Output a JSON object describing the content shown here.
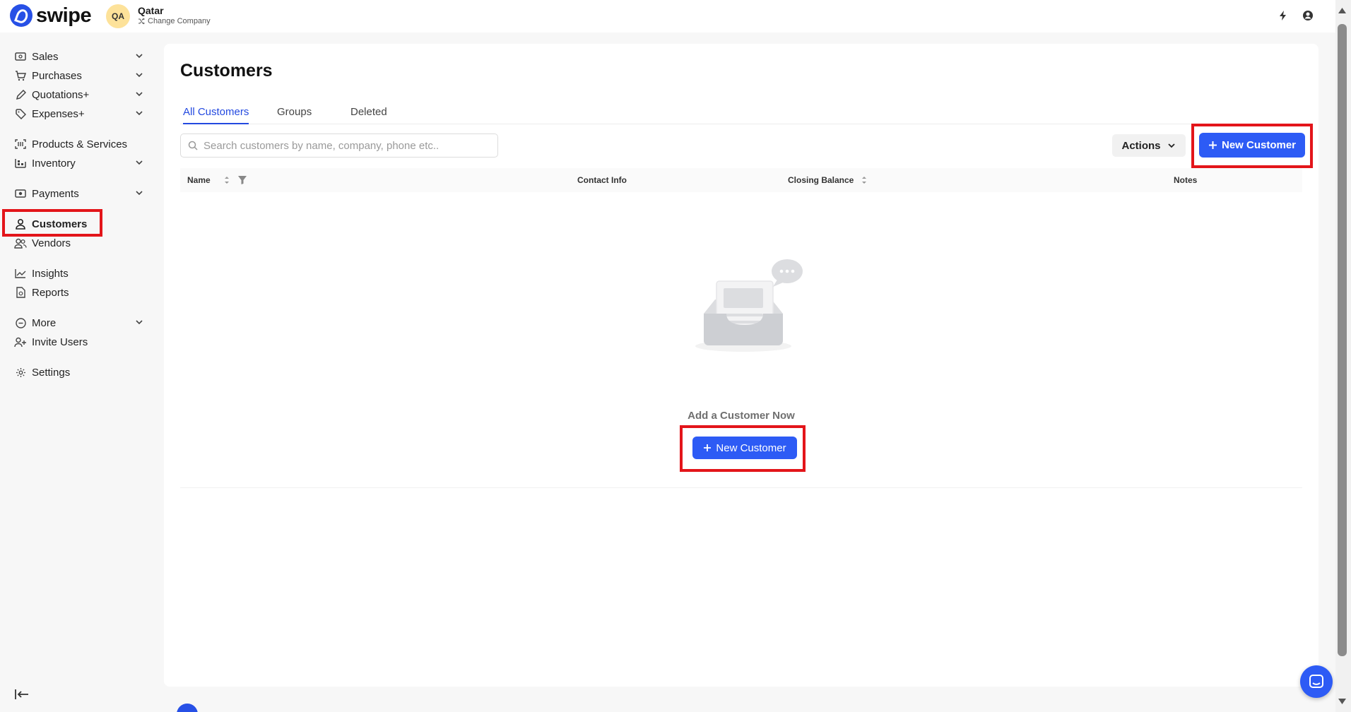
{
  "app": {
    "brand": "swipe",
    "company_initials": "QA",
    "company_name": "Qatar",
    "change_company": "Change Company"
  },
  "sidebar": {
    "items": [
      {
        "label": "Sales",
        "icon": "cash-icon",
        "has_chevron": true
      },
      {
        "label": "Purchases",
        "icon": "cart-icon",
        "has_chevron": true
      },
      {
        "label": "Quotations+",
        "icon": "pencil-icon",
        "has_chevron": true
      },
      {
        "label": "Expenses+",
        "icon": "tag-icon",
        "has_chevron": true
      },
      {
        "label": "Products & Services",
        "icon": "barcode-icon",
        "has_chevron": false
      },
      {
        "label": "Inventory",
        "icon": "warehouse-icon",
        "has_chevron": true
      },
      {
        "label": "Payments",
        "icon": "money-icon",
        "has_chevron": true
      },
      {
        "label": "Customers",
        "icon": "user-icon",
        "has_chevron": false,
        "active": true
      },
      {
        "label": "Vendors",
        "icon": "users-icon",
        "has_chevron": false
      },
      {
        "label": "Insights",
        "icon": "chart-icon",
        "has_chevron": false
      },
      {
        "label": "Reports",
        "icon": "file-icon",
        "has_chevron": false
      },
      {
        "label": "More",
        "icon": "more-circle-icon",
        "has_chevron": true
      },
      {
        "label": "Invite Users",
        "icon": "user-plus-icon",
        "has_chevron": false
      },
      {
        "label": "Settings",
        "icon": "gear-icon",
        "has_chevron": false
      }
    ]
  },
  "main": {
    "title": "Customers",
    "tabs": [
      {
        "label": "All Customers",
        "active": true
      },
      {
        "label": "Groups",
        "active": false
      },
      {
        "label": "Deleted",
        "active": false
      }
    ],
    "search_placeholder": "Search customers by name, company, phone etc..",
    "actions_label": "Actions",
    "new_customer_label": "New Customer",
    "columns": [
      "Name",
      "Contact Info",
      "Closing Balance",
      "Notes"
    ],
    "empty_text": "Add a Customer Now",
    "empty_button_label": "New Customer"
  },
  "colors": {
    "accent": "#2d5bf5",
    "highlight": "#e3151a",
    "active_tab": "#2349e0"
  }
}
